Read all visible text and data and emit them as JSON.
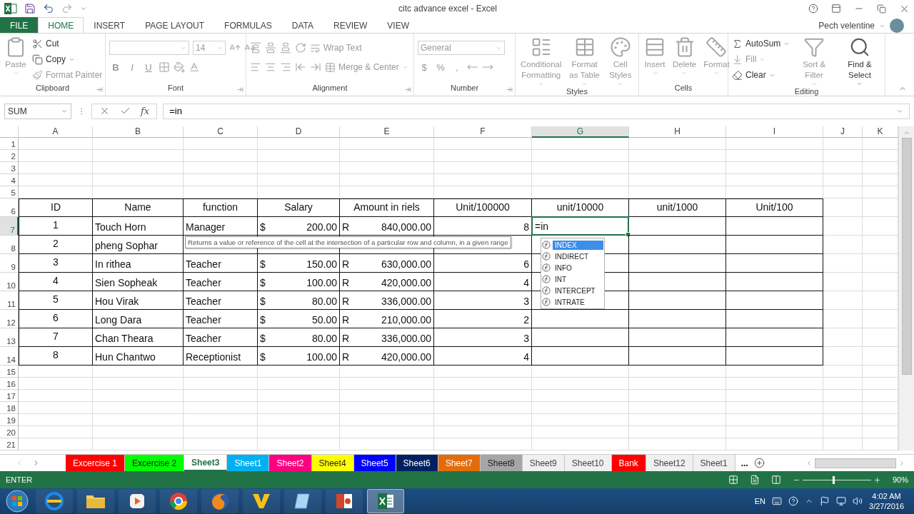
{
  "window": {
    "title": "citc advance excel - Excel",
    "user": "Pech velentine"
  },
  "ribbon_tabs": [
    {
      "label": "FILE",
      "kind": "file",
      "selected": false
    },
    {
      "label": "HOME",
      "kind": "tab",
      "selected": true
    },
    {
      "label": "INSERT",
      "kind": "tab",
      "selected": false
    },
    {
      "label": "PAGE LAYOUT",
      "kind": "tab",
      "selected": false
    },
    {
      "label": "FORMULAS",
      "kind": "tab",
      "selected": false
    },
    {
      "label": "DATA",
      "kind": "tab",
      "selected": false
    },
    {
      "label": "REVIEW",
      "kind": "tab",
      "selected": false
    },
    {
      "label": "VIEW",
      "kind": "tab",
      "selected": false
    }
  ],
  "ribbon_groups": [
    {
      "label": "Clipboard",
      "kind": "columns",
      "launcher": true,
      "items": [
        {
          "kind": "large",
          "label": "Paste",
          "disabled": true,
          "menu": true
        },
        {
          "kind": "small",
          "label": "Cut",
          "disabled": false,
          "menu": false
        },
        {
          "kind": "small",
          "label": "Copy",
          "disabled": false,
          "menu": true
        },
        {
          "kind": "small",
          "label": "Format Painter",
          "disabled": true,
          "menu": false
        }
      ]
    },
    {
      "label": "Font",
      "kind": "rows",
      "launcher": true,
      "rows": [
        [
          {
            "kind": "field",
            "disabled": true
          },
          {
            "kind": "field",
            "value": "14",
            "disabled": true
          },
          {
            "kind": "icon",
            "disabled": true
          },
          {
            "kind": "icon",
            "disabled": true
          }
        ],
        [
          {
            "kind": "bold",
            "label": "B",
            "disabled": true
          },
          {
            "kind": "italic",
            "label": "I",
            "disabled": true
          },
          {
            "kind": "underline",
            "label": "U",
            "disabled": true
          },
          {
            "kind": "icon",
            "disabled": true
          },
          {
            "kind": "icon",
            "disabled": true
          },
          {
            "kind": "icon",
            "disabled": true
          }
        ]
      ]
    },
    {
      "label": "Alignment",
      "kind": "rows",
      "launcher": true,
      "rows": [
        [
          {
            "kind": "icon",
            "disabled": true
          },
          {
            "kind": "icon",
            "disabled": true
          },
          {
            "kind": "icon",
            "disabled": true
          },
          {
            "kind": "icon",
            "disabled": true
          },
          {
            "kind": "small",
            "label": "Wrap Text",
            "disabled": true,
            "menu": false
          }
        ],
        [
          {
            "kind": "icon",
            "disabled": true
          },
          {
            "kind": "icon",
            "disabled": true
          },
          {
            "kind": "icon",
            "disabled": true
          },
          {
            "kind": "icon",
            "disabled": true
          },
          {
            "kind": "icon",
            "disabled": true
          },
          {
            "kind": "small",
            "label": "Merge & Center",
            "disabled": true,
            "menu": true
          }
        ]
      ]
    },
    {
      "label": "Number",
      "kind": "rows",
      "launcher": true,
      "rows": [
        [
          {
            "kind": "field",
            "value": "General",
            "disabled": true
          }
        ],
        [
          {
            "kind": "symbol",
            "label": "$",
            "disabled": true
          },
          {
            "kind": "symbol",
            "label": "%",
            "disabled": true
          },
          {
            "kind": "symbol",
            "label": ",",
            "disabled": true
          },
          {
            "kind": "icon",
            "disabled": true
          },
          {
            "kind": "icon",
            "disabled": true
          }
        ]
      ]
    },
    {
      "label": "Styles",
      "kind": "columns",
      "launcher": false,
      "items": [
        {
          "kind": "large",
          "label": "Conditional Formatting",
          "disabled": true,
          "menu": true
        },
        {
          "kind": "large",
          "label": "Format as Table",
          "disabled": true,
          "menu": true
        },
        {
          "kind": "large",
          "label": "Cell Styles",
          "disabled": true,
          "menu": true
        }
      ]
    },
    {
      "label": "Cells",
      "kind": "columns",
      "launcher": false,
      "items": [
        {
          "kind": "large",
          "label": "Insert",
          "disabled": true,
          "menu": true
        },
        {
          "kind": "large",
          "label": "Delete",
          "disabled": true,
          "menu": true
        },
        {
          "kind": "large",
          "label": "Format",
          "disabled": true,
          "menu": true
        }
      ]
    },
    {
      "label": "Editing",
      "kind": "columns",
      "launcher": false,
      "items": [
        {
          "kind": "small",
          "label": "AutoSum",
          "disabled": false,
          "menu": true
        },
        {
          "kind": "small",
          "label": "Fill",
          "disabled": true,
          "menu": true
        },
        {
          "kind": "small",
          "label": "Clear",
          "disabled": false,
          "menu": true
        },
        {
          "kind": "large",
          "label": "Sort & Filter",
          "disabled": true,
          "menu": true
        },
        {
          "kind": "large",
          "label": "Find & Select",
          "disabled": false,
          "menu": true
        }
      ]
    }
  ],
  "formula_bar": {
    "name_box": "SUM",
    "insert_function": "fx",
    "value": "=in"
  },
  "sheet": {
    "columns": [
      {
        "label": "A",
        "selected": false
      },
      {
        "label": "B",
        "selected": false
      },
      {
        "label": "C",
        "selected": false
      },
      {
        "label": "D",
        "selected": false
      },
      {
        "label": "E",
        "selected": false
      },
      {
        "label": "F",
        "selected": false
      },
      {
        "label": "G",
        "selected": true
      },
      {
        "label": "H",
        "selected": false
      },
      {
        "label": "I",
        "selected": false
      },
      {
        "label": "J",
        "selected": false
      },
      {
        "label": "K",
        "selected": false
      }
    ],
    "rows": [
      {
        "number": "1",
        "kind": "blank",
        "selected": false
      },
      {
        "number": "2",
        "kind": "blank",
        "selected": false
      },
      {
        "number": "3",
        "kind": "blank",
        "selected": false
      },
      {
        "number": "4",
        "kind": "blank",
        "selected": false
      },
      {
        "number": "5",
        "kind": "blank",
        "selected": false
      },
      {
        "number": "6",
        "kind": "table",
        "selected": false,
        "cells": [
          {
            "kind": "center",
            "text": "ID"
          },
          {
            "kind": "center",
            "text": "Name"
          },
          {
            "kind": "center",
            "text": "function"
          },
          {
            "kind": "center",
            "text": "Salary"
          },
          {
            "kind": "center",
            "text": "Amount in riels"
          },
          {
            "kind": "center",
            "text": "Unit/100000"
          },
          {
            "kind": "center",
            "text": "unit/10000"
          },
          {
            "kind": "center",
            "text": "unit/1000"
          },
          {
            "kind": "center",
            "text": "Unit/100"
          }
        ]
      },
      {
        "number": "7",
        "kind": "table",
        "selected": true,
        "cells": [
          {
            "kind": "center",
            "text": "1"
          },
          {
            "kind": "text",
            "text": "Touch  Horn"
          },
          {
            "kind": "text",
            "text": "Manager"
          },
          {
            "kind": "currency",
            "symbol": "$",
            "text": "200.00"
          },
          {
            "kind": "currency",
            "symbol": "R",
            "text": "840,000.00"
          },
          {
            "kind": "number",
            "text": "8"
          },
          {
            "kind": "edit",
            "text": "=in"
          }
        ]
      },
      {
        "number": "8",
        "kind": "table",
        "selected": false,
        "cells": [
          {
            "kind": "center",
            "text": "2"
          },
          {
            "kind": "text",
            "text": "pheng  Sophar"
          }
        ]
      },
      {
        "number": "9",
        "kind": "table",
        "selected": false,
        "cells": [
          {
            "kind": "center",
            "text": "3"
          },
          {
            "kind": "text",
            "text": "In  rithea"
          },
          {
            "kind": "text",
            "text": "Teacher"
          },
          {
            "kind": "currency",
            "symbol": "$",
            "text": "150.00"
          },
          {
            "kind": "currency",
            "symbol": "R",
            "text": "630,000.00"
          },
          {
            "kind": "number",
            "text": "6"
          }
        ]
      },
      {
        "number": "10",
        "kind": "table",
        "selected": false,
        "cells": [
          {
            "kind": "center",
            "text": "4"
          },
          {
            "kind": "text",
            "text": "Sien  Sopheak"
          },
          {
            "kind": "text",
            "text": "Teacher"
          },
          {
            "kind": "currency",
            "symbol": "$",
            "text": "100.00"
          },
          {
            "kind": "currency",
            "symbol": "R",
            "text": "420,000.00"
          },
          {
            "kind": "number",
            "text": "4"
          }
        ]
      },
      {
        "number": "11",
        "kind": "table",
        "selected": false,
        "cells": [
          {
            "kind": "center",
            "text": "5"
          },
          {
            "kind": "text",
            "text": "Hou Virak"
          },
          {
            "kind": "text",
            "text": "Teacher"
          },
          {
            "kind": "currency",
            "symbol": "$",
            "text": "80.00"
          },
          {
            "kind": "currency",
            "symbol": "R",
            "text": "336,000.00"
          },
          {
            "kind": "number",
            "text": "3"
          }
        ]
      },
      {
        "number": "12",
        "kind": "table",
        "selected": false,
        "cells": [
          {
            "kind": "center",
            "text": "6"
          },
          {
            "kind": "text",
            "text": "Long  Dara"
          },
          {
            "kind": "text",
            "text": "Teacher"
          },
          {
            "kind": "currency",
            "symbol": "$",
            "text": "50.00"
          },
          {
            "kind": "currency",
            "symbol": "R",
            "text": "210,000.00"
          },
          {
            "kind": "number",
            "text": "2"
          }
        ]
      },
      {
        "number": "13",
        "kind": "table",
        "selected": false,
        "cells": [
          {
            "kind": "center",
            "text": "7"
          },
          {
            "kind": "text",
            "text": "Chan  Theara"
          },
          {
            "kind": "text",
            "text": "Teacher"
          },
          {
            "kind": "currency",
            "symbol": "$",
            "text": "80.00"
          },
          {
            "kind": "currency",
            "symbol": "R",
            "text": "336,000.00"
          },
          {
            "kind": "number",
            "text": "3"
          }
        ]
      },
      {
        "number": "14",
        "kind": "table",
        "selected": false,
        "cells": [
          {
            "kind": "center",
            "text": "8"
          },
          {
            "kind": "text",
            "text": "Hun  Chantwo"
          },
          {
            "kind": "text",
            "text": "Receptionist"
          },
          {
            "kind": "currency",
            "symbol": "$",
            "text": "100.00"
          },
          {
            "kind": "currency",
            "symbol": "R",
            "text": "420,000.00"
          },
          {
            "kind": "number",
            "text": "4"
          }
        ]
      },
      {
        "number": "15",
        "kind": "blank",
        "selected": false
      },
      {
        "number": "16",
        "kind": "blank",
        "selected": false
      },
      {
        "number": "17",
        "kind": "blank",
        "selected": false
      },
      {
        "number": "18",
        "kind": "blank",
        "selected": false
      },
      {
        "number": "19",
        "kind": "blank",
        "selected": false
      },
      {
        "number": "20",
        "kind": "blank",
        "selected": false
      },
      {
        "number": "21",
        "kind": "blank",
        "selected": false
      }
    ],
    "tooltip": "Returns a value or reference of the cell at the intersection of a particular row and column, in a given range",
    "autocomplete": [
      {
        "label": "INDEX",
        "selected": true
      },
      {
        "label": "INDIRECT",
        "selected": false
      },
      {
        "label": "INFO",
        "selected": false
      },
      {
        "label": "INT",
        "selected": false
      },
      {
        "label": "INTERCEPT",
        "selected": false
      },
      {
        "label": "INTRATE",
        "selected": false
      }
    ]
  },
  "sheet_tabs": [
    {
      "label": "Excercise 1",
      "selected": false,
      "color": "#ff0000"
    },
    {
      "label": "Excercise 2",
      "selected": false,
      "color": "#00ff00"
    },
    {
      "label": "Sheet3",
      "selected": true
    },
    {
      "label": "Sheet1",
      "selected": false,
      "color": "#00b0f0"
    },
    {
      "label": "Sheet2",
      "selected": false,
      "color": "#ff0080"
    },
    {
      "label": "Sheet4",
      "selected": false,
      "color": "#ffff00"
    },
    {
      "label": "Sheet5",
      "selected": false,
      "color": "#0000ff"
    },
    {
      "label": "Sheet6",
      "selected": false,
      "color": "#002060"
    },
    {
      "label": "Sheet7",
      "selected": false,
      "color": "#e36c0a"
    },
    {
      "label": "Sheet8",
      "selected": false,
      "color": "#a6a6a6"
    },
    {
      "label": "Sheet9",
      "selected": false
    },
    {
      "label": "Sheet10",
      "selected": false
    },
    {
      "label": "Bank",
      "selected": false,
      "color": "#ff0000"
    },
    {
      "label": "Sheet12",
      "selected": false
    },
    {
      "label": "Sheet1",
      "selected": false
    }
  ],
  "more_tabs": "...",
  "status_bar": {
    "mode": "ENTER",
    "zoom": "90%",
    "zoom_slider": {
      "level": 0.45
    }
  },
  "taskbar": {
    "apps": [
      {
        "selected": false
      },
      {
        "selected": false
      },
      {
        "selected": false
      },
      {
        "selected": false
      },
      {
        "selected": false
      },
      {
        "selected": false
      },
      {
        "selected": false
      },
      {
        "selected": false
      },
      {
        "selected": true
      }
    ],
    "language": "EN",
    "time": "4:02 AM",
    "date": "3/27/2016"
  }
}
